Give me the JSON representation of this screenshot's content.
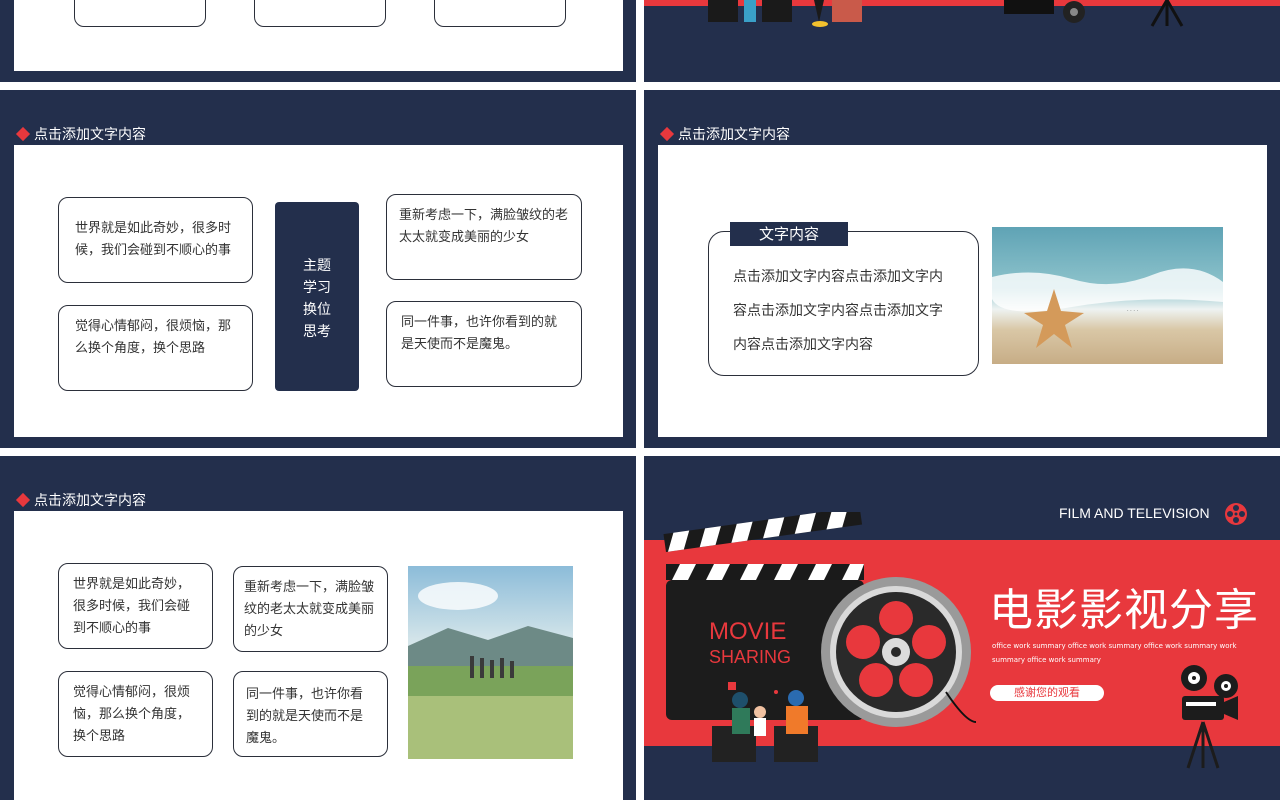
{
  "colors": {
    "navy": "#232f4c",
    "red": "#e8383d",
    "white": "#ffffff"
  },
  "slide_header": "点击添加文字内容",
  "slide3": {
    "box1": "世界就是如此奇妙，很多时候，我们会碰到不顺心的事",
    "box2": "觉得心情郁闷，很烦恼，那么换个角度，换个思路",
    "center": [
      "主题",
      "学习",
      "换位",
      "思考"
    ],
    "box3": "重新考虑一下，满脸皱纹的老太太就变成美丽的少女",
    "box4": "同一件事，也许你看到的就是天使而不是魔鬼。"
  },
  "slide4": {
    "tab": "文字内容",
    "lines": [
      "点击添加文字内容点击添加文字内",
      "容点击添加文字内容点击添加文字",
      "内容点击添加文字内容"
    ]
  },
  "slide5": {
    "box1": "世界就是如此奇妙，很多时候，我们会碰到不顺心的事",
    "box2": "重新考虑一下，满脸皱纹的老太太就变成美丽的少女",
    "box3": "觉得心情郁闷，很烦恼，那么换个角度，换个思路",
    "box4": "同一件事，也许你看到的就是天使而不是魔鬼。"
  },
  "slide6": {
    "film_label": "FILM AND TELEVISION",
    "title": "电影影视分享",
    "movie": "MOVIE",
    "sharing": "SHARING",
    "summary1": "office work summary office work summary office work summary work",
    "summary2": "summary office work summary",
    "thanks": "感谢您的观看"
  }
}
